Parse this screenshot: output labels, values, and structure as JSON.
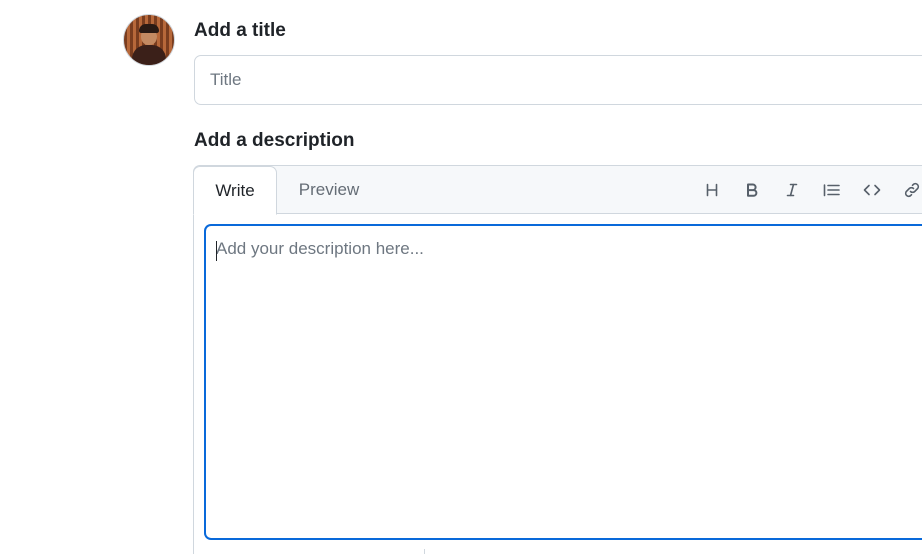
{
  "title_section": {
    "label": "Add a title",
    "placeholder": "Title",
    "value": ""
  },
  "description_section": {
    "label": "Add a description",
    "tabs": [
      {
        "label": "Write",
        "active": true
      },
      {
        "label": "Preview",
        "active": false
      }
    ],
    "toolbar": [
      {
        "icon": "heading-icon"
      },
      {
        "icon": "bold-icon"
      },
      {
        "icon": "italic-icon"
      },
      {
        "icon": "quote-icon"
      },
      {
        "icon": "code-icon"
      },
      {
        "icon": "link-icon"
      }
    ],
    "textarea": {
      "placeholder": "Add your description here...",
      "value": ""
    }
  },
  "colors": {
    "focus_border": "#0969da",
    "border": "#d0d7de",
    "header_bg": "#f6f8fa",
    "muted_text": "#656d76"
  }
}
